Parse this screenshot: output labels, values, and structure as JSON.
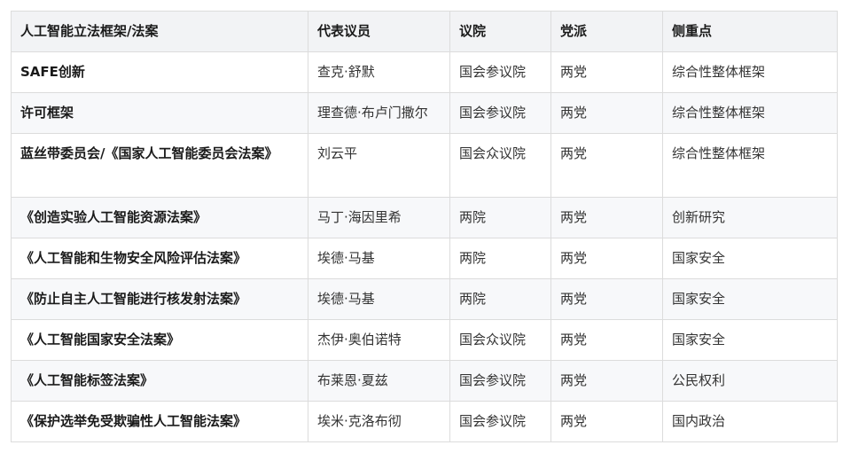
{
  "headers": [
    "人工智能立法框架/法案",
    "代表议员",
    "议院",
    "党派",
    "侧重点"
  ],
  "rows": [
    [
      "SAFE创新",
      "查克·舒默",
      "国会参议院",
      "两党",
      "综合性整体框架"
    ],
    [
      "许可框架",
      "理查德·布卢门撒尔",
      "国会参议院",
      "两党",
      "综合性整体框架"
    ],
    [
      "蓝丝带委员会/《国家人工智能委员会法案》",
      "刘云平",
      "国会众议院",
      "两党",
      "综合性整体框架"
    ],
    [
      "《创造实验人工智能资源法案》",
      "马丁·海因里希",
      "两院",
      "两党",
      "创新研究"
    ],
    [
      "《人工智能和生物安全风险评估法案》",
      "埃德·马基",
      "两院",
      "两党",
      "国家安全"
    ],
    [
      "《防止自主人工智能进行核发射法案》",
      "埃德·马基",
      "两院",
      "两党",
      "国家安全"
    ],
    [
      "《人工智能国家安全法案》",
      "杰伊·奥伯诺特",
      "国会众议院",
      "两党",
      "国家安全"
    ],
    [
      "《人工智能标签法案》",
      "布莱恩·夏兹",
      "国会参议院",
      "两党",
      "公民权利"
    ],
    [
      "《保护选举免受欺骗性人工智能法案》",
      "埃米·克洛布彻",
      "国会参议院",
      "两党",
      "国内政治"
    ]
  ]
}
